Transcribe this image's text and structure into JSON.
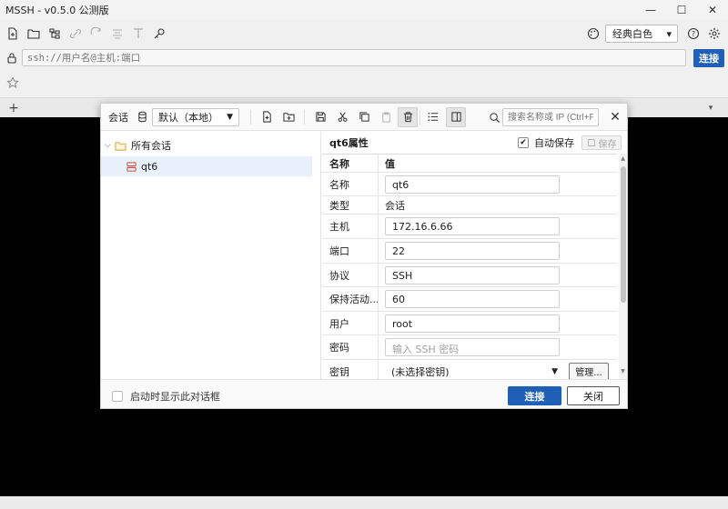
{
  "window": {
    "title": "MSSH - v0.5.0 公测版",
    "minimize": "—",
    "maximize": "☐",
    "close": "✕"
  },
  "toolbar": {
    "theme_label": "经典白色",
    "help": "?",
    "theme_arrow": "▾"
  },
  "address": {
    "placeholder": "ssh://用户名@主机:端口",
    "connect_label": "连接"
  },
  "tabs": {
    "add": "+",
    "menu": "▾"
  },
  "dialog": {
    "sessions_label": "会话",
    "profile": "默认（本地）",
    "search_placeholder": "搜索名称或 IP (Ctrl+F)",
    "close": "✕",
    "tree": {
      "root": "所有会话",
      "item": "qt6"
    },
    "props": {
      "title": "qt6属性",
      "autosave_label": "自动保存",
      "save_label": "保存",
      "header_key": "名称",
      "header_value": "值",
      "rows": [
        {
          "key": "名称",
          "value": "qt6"
        },
        {
          "key": "类型",
          "value": "会话"
        },
        {
          "key": "主机",
          "value": "172.16.6.66"
        },
        {
          "key": "端口",
          "value": "22"
        },
        {
          "key": "协议",
          "value": "SSH"
        },
        {
          "key": "保持活动...",
          "value": "60"
        },
        {
          "key": "用户",
          "value": "root"
        },
        {
          "key": "密码",
          "placeholder": "输入 SSH 密码"
        },
        {
          "key": "密钥",
          "value": "(未选择密钥)",
          "manage": "管理..."
        }
      ]
    },
    "footer": {
      "startup_label": "启动时显示此对话框",
      "connect": "连接",
      "close": "关闭"
    }
  },
  "colors": {
    "accent": "#1f5fb5",
    "terminal_bg": "#000000",
    "selection": "#e8f0fb"
  }
}
